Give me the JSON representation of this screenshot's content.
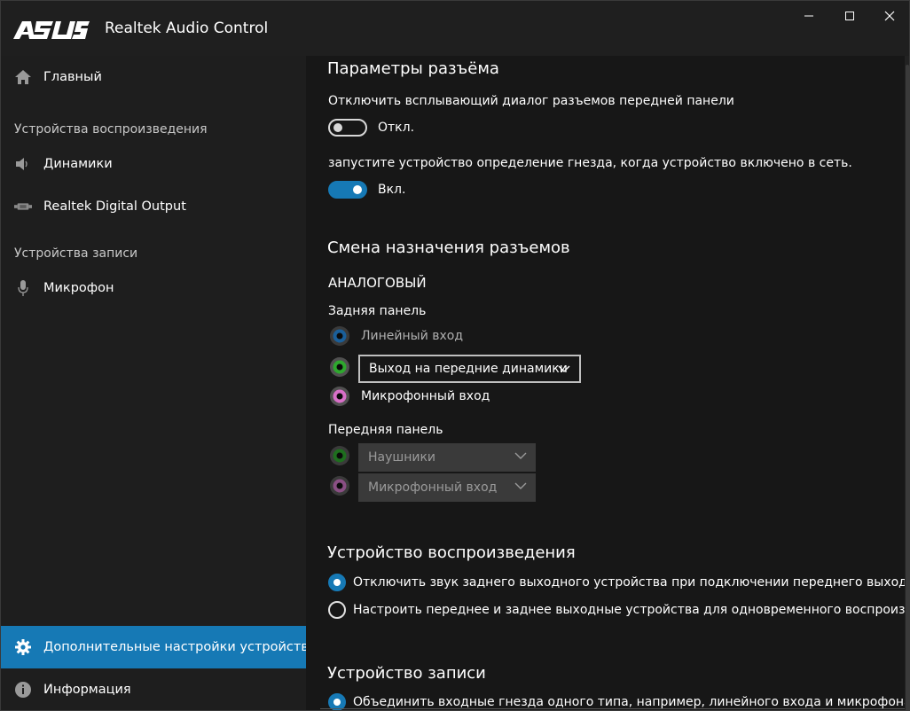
{
  "window": {
    "brand": "ASUS",
    "title": "Realtek Audio Control"
  },
  "sidebar": {
    "home_label": "Главный",
    "playback_header": "Устройства воспроизведения",
    "playback_items": [
      "Динамики",
      "Realtek Digital Output"
    ],
    "recording_header": "Устройства записи",
    "recording_items": [
      "Микрофон"
    ],
    "advanced_label": "Дополнительные настройки устройства",
    "info_label": "Информация"
  },
  "connector_settings": {
    "title": "Параметры разъёма",
    "option1_text": "Отключить всплывающий диалог разъемов передней панели",
    "option1_state": "Откл.",
    "option1_on": false,
    "option2_text": "запустите устройство определение гнезда, когда  устройство включено в сеть.",
    "option2_state": "Вкл.",
    "option2_on": true
  },
  "reassign": {
    "title": "Смена назначения разъемов",
    "analog_label": "АНАЛОГОВЫЙ",
    "rear_panel_label": "Задняя панель",
    "rear_jacks": [
      {
        "label": "Линейный вход",
        "color": "#1a6fb0"
      },
      {
        "label": "Выход на передние динамики",
        "color": "#2ea82e"
      },
      {
        "label": "Микрофонный вход",
        "color": "#d86fc8"
      }
    ],
    "front_panel_label": "Передняя панель",
    "front_jacks": [
      {
        "label": "Наушники",
        "color": "#2ea82e"
      },
      {
        "label": "Микрофонный вход",
        "color": "#c070b8"
      }
    ]
  },
  "playback_device": {
    "title": "Устройство воспроизведения",
    "option1": "Отключить звук заднего выходного устройства при подключении переднего выходного ус",
    "option2": "Настроить переднее и заднее выходные устройства для одновременного воспроизведени"
  },
  "recording_device": {
    "title": "Устройство записи",
    "option1": "Объединить входные гнезда одного типа, например, линейного входа и микрофона в каче"
  },
  "colors": {
    "accent": "#1679b5",
    "background": "#171717",
    "sidebar": "#1e1e1e"
  }
}
